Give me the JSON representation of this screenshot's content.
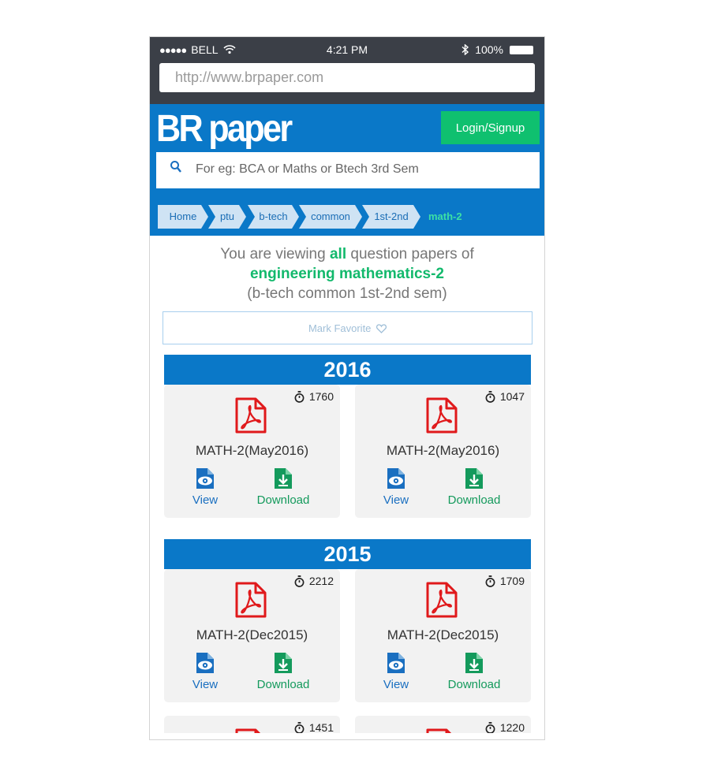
{
  "status_bar": {
    "carrier": "BELL",
    "signal_dots": "●●●●●",
    "time": "4:21 PM",
    "battery": "100%"
  },
  "browser": {
    "url": "http://www.brpaper.com"
  },
  "header": {
    "logo": "BR paper",
    "login_label": "Login/Signup",
    "search_placeholder": "For eg: BCA or Maths or Btech 3rd Sem"
  },
  "breadcrumb": {
    "items": [
      "Home",
      "ptu",
      "b-tech",
      "common",
      "1st-2nd"
    ],
    "current": "math-2"
  },
  "intro": {
    "line1_prefix": "You are viewing ",
    "line1_highlight": "all",
    "line1_suffix": " question papers of",
    "subject": "engineering mathematics-2",
    "context": "(b-tech common 1st-2nd sem)"
  },
  "favorite_label": "Mark Favorite",
  "actions": {
    "view": "View",
    "download": "Download"
  },
  "sections": [
    {
      "year": "2016",
      "papers": [
        {
          "title": "MATH-2(May2016)",
          "views": "1760"
        },
        {
          "title": "MATH-2(May2016)",
          "views": "1047"
        }
      ]
    },
    {
      "year": "2015",
      "papers": [
        {
          "title": "MATH-2(Dec2015)",
          "views": "2212"
        },
        {
          "title": "MATH-2(Dec2015)",
          "views": "1709"
        },
        {
          "title": "",
          "views": "1451"
        },
        {
          "title": "",
          "views": "1220"
        }
      ]
    }
  ],
  "colors": {
    "brand_blue": "#0a78c8",
    "accent_green": "#0fc06f",
    "pdf_red": "#e0191b"
  }
}
